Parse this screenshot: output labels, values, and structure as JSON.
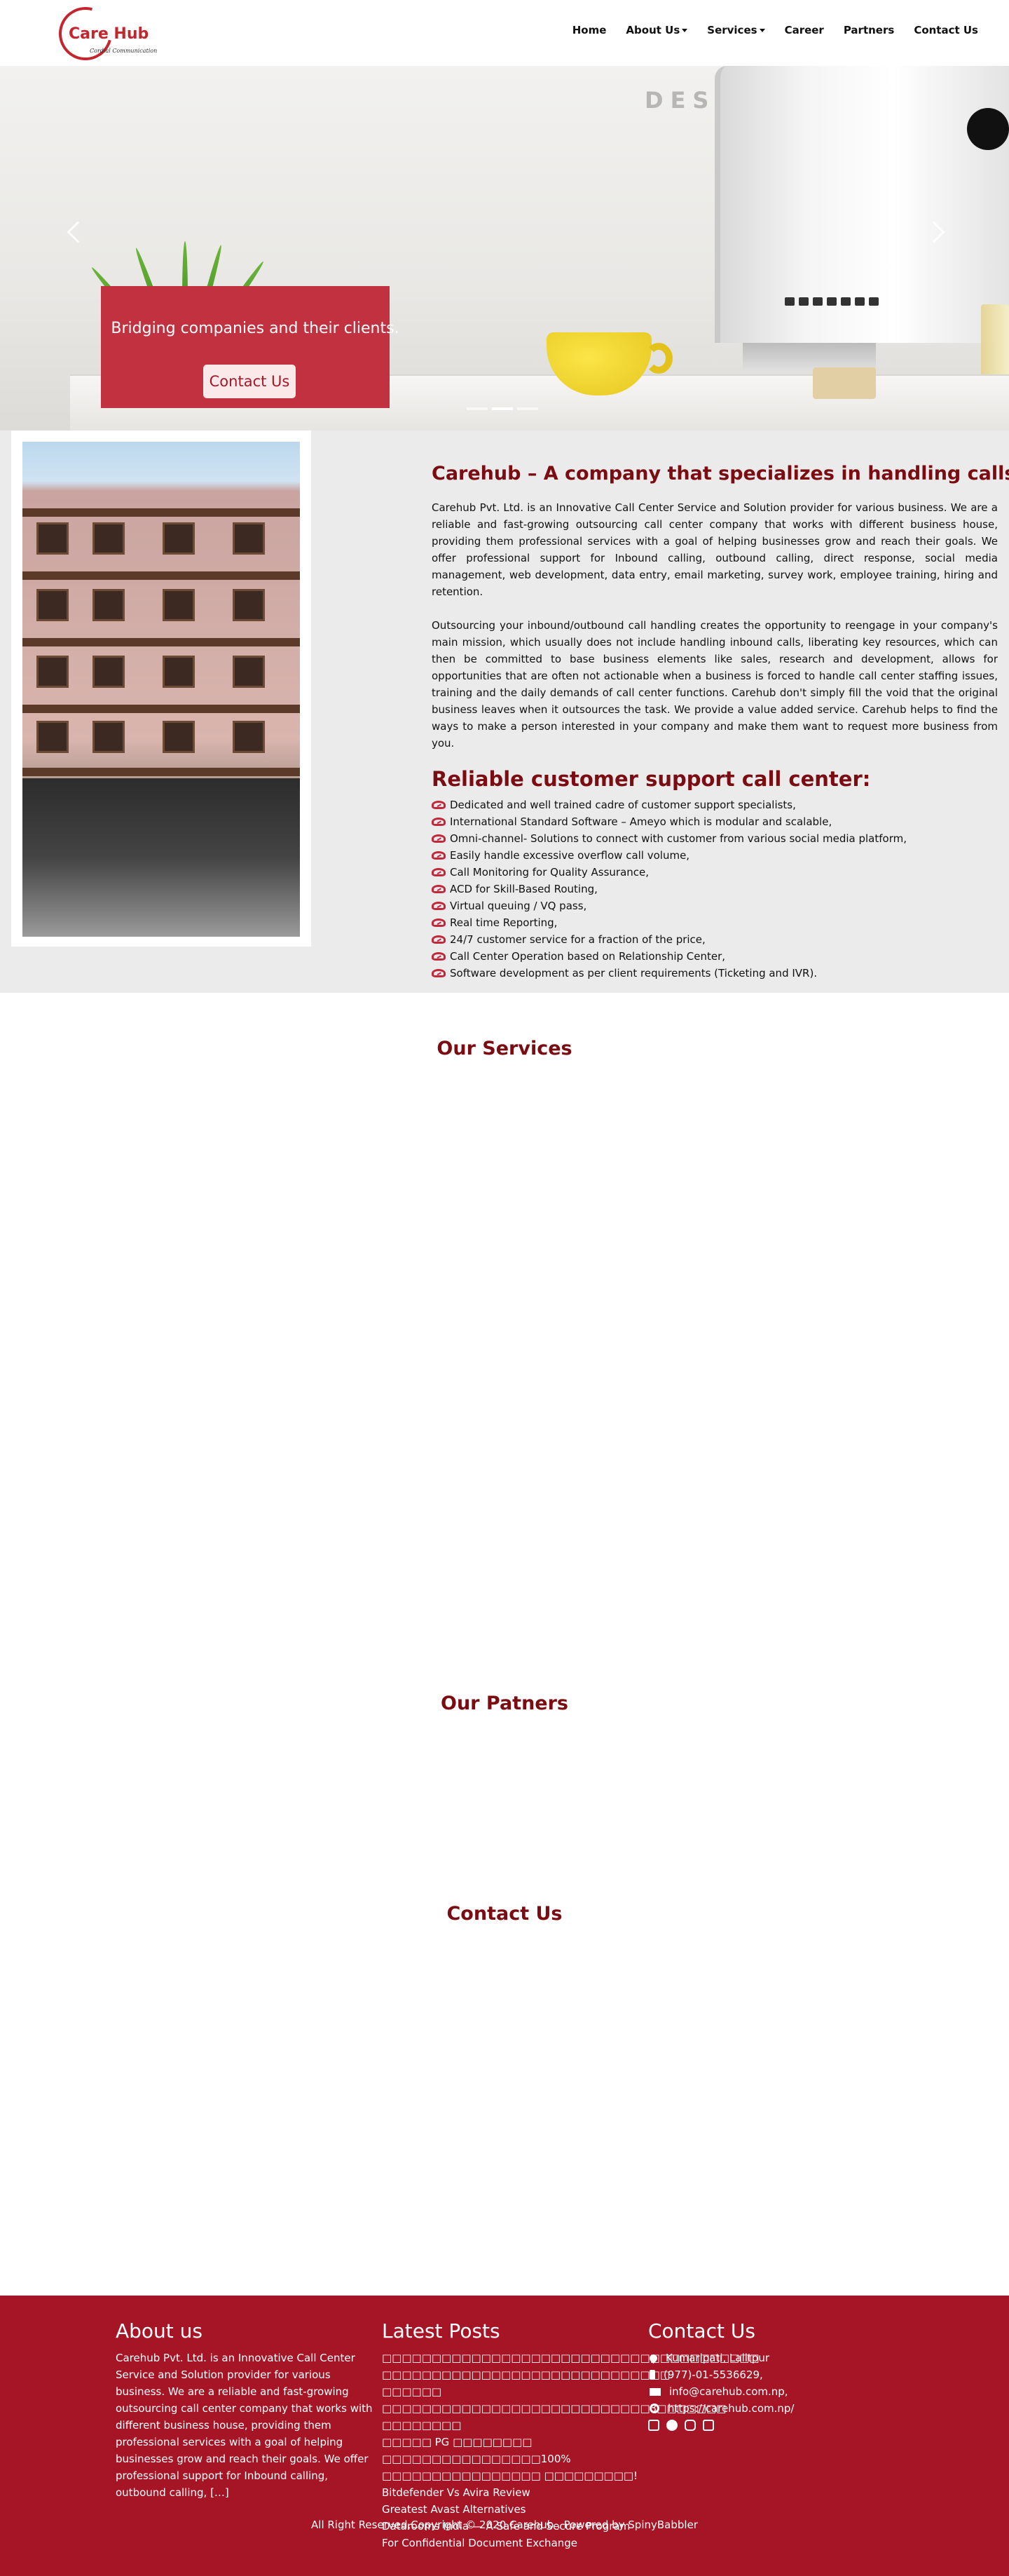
{
  "brand": {
    "name": "Care Hub",
    "tagline": "Cordial Communication"
  },
  "nav": {
    "items": [
      {
        "label": "Home",
        "dropdown": false
      },
      {
        "label": "About Us",
        "dropdown": true
      },
      {
        "label": "Services",
        "dropdown": true
      },
      {
        "label": "Career",
        "dropdown": false
      },
      {
        "label": "Partners",
        "dropdown": false
      },
      {
        "label": "Contact Us",
        "dropdown": false
      }
    ]
  },
  "hero": {
    "caption": "Bridging companies and their clients.",
    "button": "Contact Us",
    "slides": 3,
    "active_slide": 2
  },
  "about": {
    "title": "Carehub – A company that specializes in handling calls.",
    "paragraph1": "Carehub Pvt. Ltd. is an Innovative Call Center Service and Solution provider for various business. We are a reliable and fast-growing outsourcing call center company that works with different business house, providing them professional services with a goal of helping businesses grow and reach their goals. We offer professional support for Inbound calling, outbound calling, direct response, social media management, web development, data entry, email marketing, survey work, employee training, hiring and retention.",
    "paragraph2": "Outsourcing your inbound/outbound call handling creates the opportunity to reengage in your company's main mission, which usually does not include handling inbound calls, liberating key resources, which can then be committed to base business elements like sales, research and development, allows for opportunities that are often not actionable when a business is forced to handle call center staffing issues, training and the daily demands of call center functions. Carehub don't simply fill the void that the original business leaves when it outsources the task. We provide a value added service. Carehub helps to find the ways to make a person interested in your company and make them want to request more business from you.",
    "support_title": "Reliable customer support call center:",
    "features": [
      "Dedicated and well trained cadre of customer support specialists,",
      "International Standard Software – Ameyo which is modular and scalable,",
      "Omni-channel- Solutions to connect with customer from various social media platform,",
      "Easily handle excessive overflow call volume,",
      "Call Monitoring for Quality Assurance,",
      "ACD for Skill-Based Routing,",
      "Virtual queuing / VQ pass,",
      "Real time Reporting,",
      "24/7 customer service for a fraction of the price,",
      "Call Center Operation based on Relationship Center,",
      "Software development as per client requirements (Ticketing and IVR)."
    ]
  },
  "sections": {
    "services": "Our Services",
    "partners": "Our Patners",
    "contact": "Contact Us"
  },
  "footer": {
    "about_title": "About us",
    "about_text": "Carehub Pvt. Ltd. is an Innovative Call Center Service and Solution provider for various business. We are a reliable and fast-growing outsourcing call center company that works with different business house, providing them professional services with a goal of helping businesses grow and reach their goals. We offer professional support for Inbound calling, outbound calling, […]",
    "posts_title": "Latest Posts",
    "posts": [
      "□□□□□□□□□□□□□□□□□□□□□□□□□□□□□□□□□□□□□□",
      "□□□□□□□□□□□□□□□□□□□□□□□□□□□□□ □□□□□□",
      "□□□□□□□□□□□□□□□□□□□□□□□□□□□3□□□□□□□ □□□□□□□□",
      "□□□□□ PG □□□□□□□□ □□□□□□□□□□□□□□□□100%",
      "□□□□□□□□□□□□□□□□ □□□□□□□□□!",
      "Bitdefender Vs Avira Review",
      "Greatest Avast Alternatives",
      "Datarooms India — A Safe and Secure Program For Confidential Document Exchange"
    ],
    "contact_title": "Contact Us",
    "address": "Kumaripati, Lalitpur",
    "phone": "(977)-01-5536629,",
    "email": "info@carehub.com.np,",
    "website": "https://carehub.com.np/",
    "copyright": "All Right Reserved,Copyright © 2020 Carehub . Powered by SpinyBabbler"
  },
  "colors": {
    "brand_red": "#a61526",
    "title_red": "#7a0c12",
    "caption_red": "#c2313f"
  },
  "icons": [
    "chevron-left-icon",
    "chevron-right-icon",
    "eye-icon",
    "map-pin-icon",
    "mobile-phone-icon",
    "envelope-icon",
    "globe-icon",
    "facebook-icon",
    "twitter-icon",
    "instagram-icon",
    "linkedin-icon"
  ]
}
